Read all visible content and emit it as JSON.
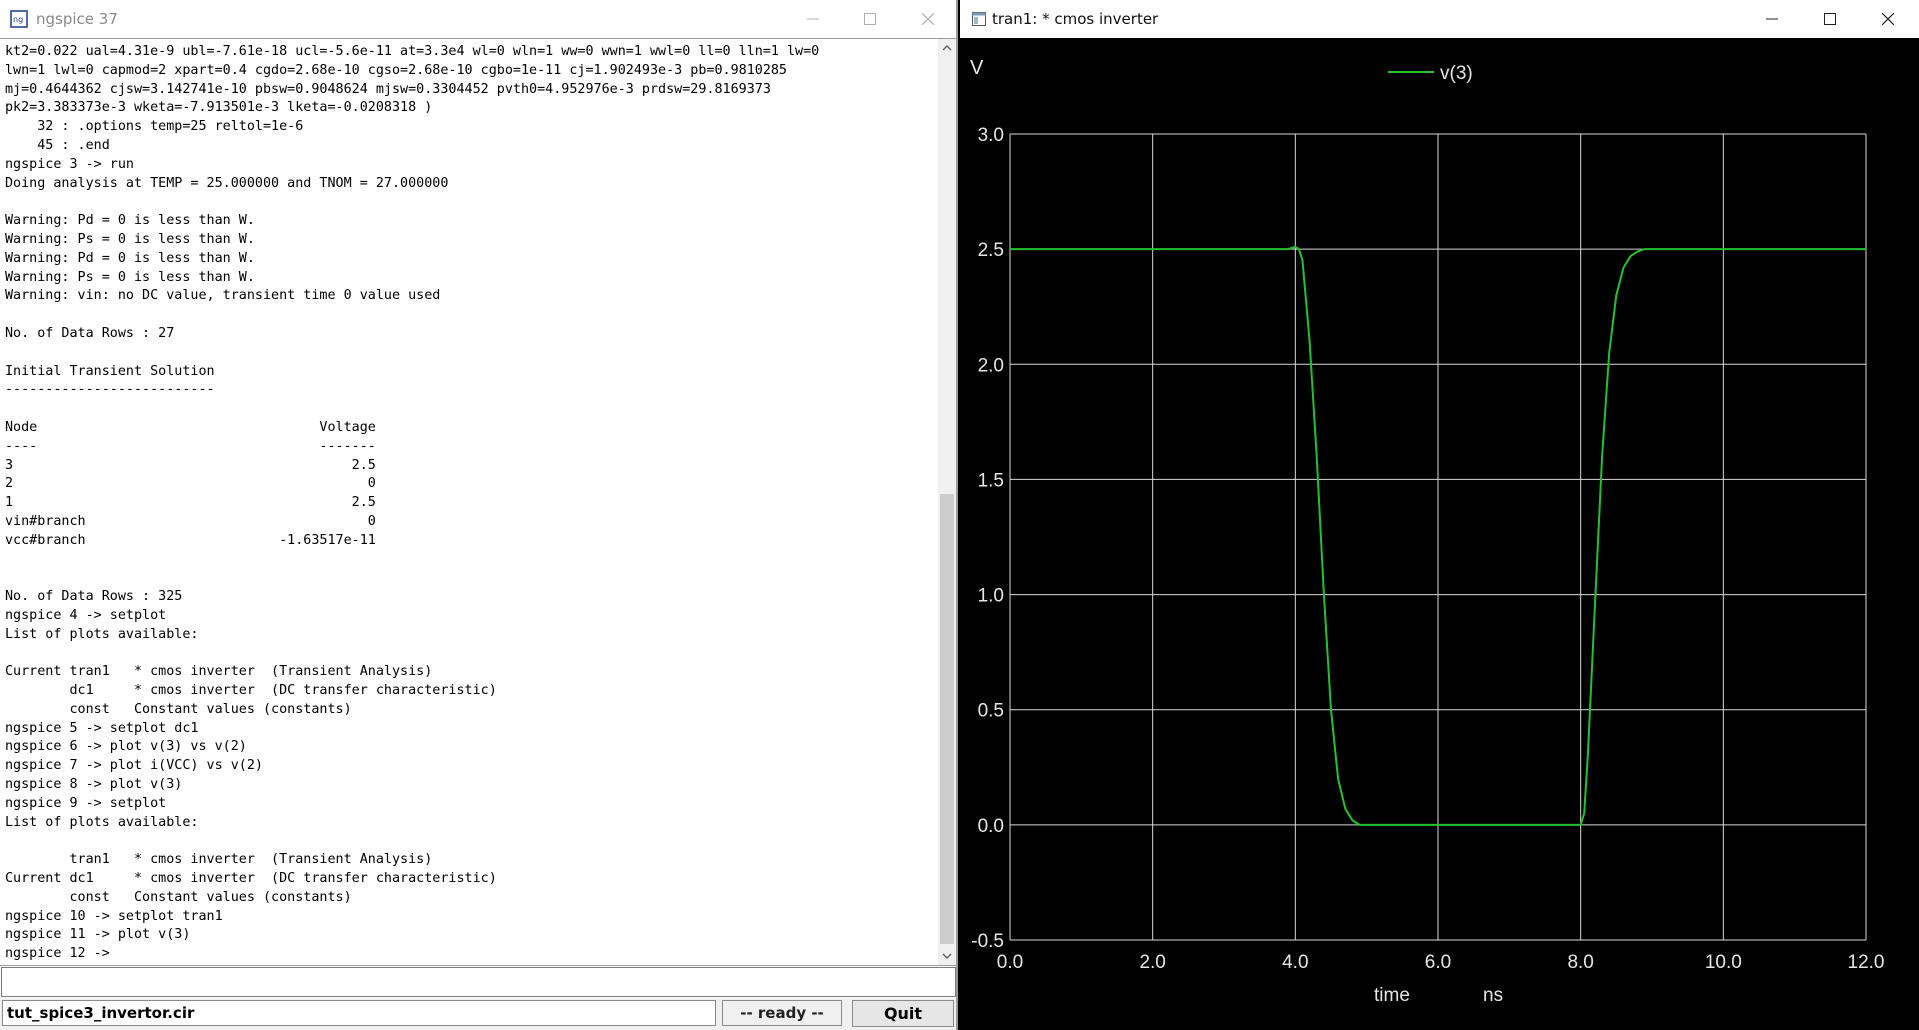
{
  "console": {
    "title": "ngspice 37",
    "lines": [
      "kt2=0.022 ual=4.31e-9 ubl=-7.61e-18 ucl=-5.6e-11 at=3.3e4 wl=0 wln=1 ww=0 wwn=1 wwl=0 ll=0 lln=1 lw=0",
      "lwn=1 lwl=0 capmod=2 xpart=0.4 cgdo=2.68e-10 cgso=2.68e-10 cgbo=1e-11 cj=1.902493e-3 pb=0.9810285",
      "mj=0.4644362 cjsw=3.142741e-10 pbsw=0.9048624 mjsw=0.3304452 pvth0=4.952976e-3 prdsw=29.8169373",
      "pk2=3.383373e-3 wketa=-7.913501e-3 lketa=-0.0208318 )",
      "    32 : .options temp=25 reltol=1e-6",
      "    45 : .end",
      "ngspice 3 -> run",
      "Doing analysis at TEMP = 25.000000 and TNOM = 27.000000",
      "",
      "Warning: Pd = 0 is less than W.",
      "Warning: Ps = 0 is less than W.",
      "Warning: Pd = 0 is less than W.",
      "Warning: Ps = 0 is less than W.",
      "Warning: vin: no DC value, transient time 0 value used",
      "",
      "No. of Data Rows : 27",
      "",
      "Initial Transient Solution",
      "--------------------------",
      "",
      "Node                                   Voltage",
      "----                                   -------",
      "3                                          2.5",
      "2                                            0",
      "1                                          2.5",
      "vin#branch                                   0",
      "vcc#branch                        -1.63517e-11",
      "",
      "",
      "No. of Data Rows : 325",
      "ngspice 4 -> setplot",
      "List of plots available:",
      "",
      "Current tran1   * cmos inverter  (Transient Analysis)",
      "        dc1     * cmos inverter  (DC transfer characteristic)",
      "        const   Constant values (constants)",
      "ngspice 5 -> setplot dc1",
      "ngspice 6 -> plot v(3) vs v(2)",
      "ngspice 7 -> plot i(VCC) vs v(2)",
      "ngspice 8 -> plot v(3)",
      "ngspice 9 -> setplot",
      "List of plots available:",
      "",
      "        tran1   * cmos inverter  (Transient Analysis)",
      "Current dc1     * cmos inverter  (DC transfer characteristic)",
      "        const   Constant values (constants)",
      "ngspice 10 -> setplot tran1",
      "ngspice 11 -> plot v(3)",
      "ngspice 12 ->"
    ],
    "input_value": "",
    "file_name": "tut_spice3_invertor.cir",
    "status": "-- ready --",
    "quit_label": "Quit"
  },
  "plot_window": {
    "title": "tran1: * cmos inverter"
  },
  "chart_data": {
    "type": "line",
    "ylabel": "V",
    "xlabel": "time",
    "xunit": "ns",
    "xlim": [
      0,
      12
    ],
    "ylim": [
      -0.5,
      3.0
    ],
    "x_ticks": [
      "0.0",
      "2.0",
      "4.0",
      "6.0",
      "8.0",
      "10.0",
      "12.0"
    ],
    "y_ticks": [
      "3.0",
      "2.5",
      "2.0",
      "1.5",
      "1.0",
      "0.5",
      "0.0",
      "-0.5"
    ],
    "grid": true,
    "legend": "top-center",
    "series": [
      {
        "name": "v(3)",
        "color": "#22c22e",
        "x": [
          0,
          3.9,
          4.0,
          4.05,
          4.1,
          4.2,
          4.3,
          4.4,
          4.5,
          4.6,
          4.7,
          4.8,
          4.9,
          5.0,
          8.0,
          8.05,
          8.1,
          8.2,
          8.3,
          8.4,
          8.5,
          8.6,
          8.7,
          8.8,
          8.9,
          9.0,
          9.1,
          12.0
        ],
        "y": [
          2.5,
          2.5,
          2.51,
          2.5,
          2.45,
          2.1,
          1.6,
          1.0,
          0.5,
          0.2,
          0.07,
          0.02,
          0.0,
          0.0,
          0.0,
          0.05,
          0.3,
          0.95,
          1.6,
          2.05,
          2.3,
          2.42,
          2.47,
          2.49,
          2.5,
          2.5,
          2.5,
          2.5
        ]
      }
    ]
  },
  "colors": {
    "plot_background": "#000000",
    "grid": "#d9d9d9",
    "axis_text": "#e6e6e6",
    "console_background": "#ffffff"
  },
  "icons": {
    "console": "ngspice-app-icon",
    "plot": "plot-window-icon"
  }
}
